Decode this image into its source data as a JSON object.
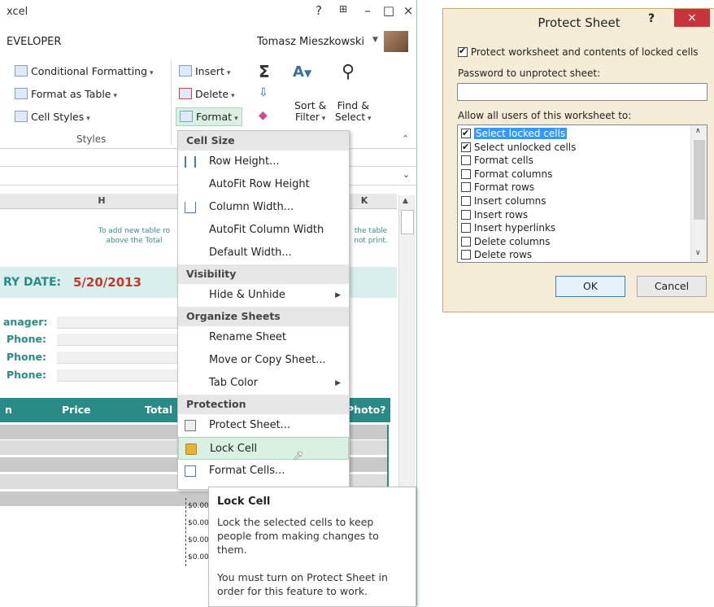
{
  "excel": {
    "title": "xcel",
    "window_buttons": [
      "?",
      "⊞",
      "–",
      "□",
      "×"
    ],
    "tab": "EVELOPER",
    "user": "Tomasz Mieszkowski",
    "ribbon": {
      "styles": {
        "conditional_formatting": "Conditional Formatting",
        "format_as_table": "Format as Table",
        "cell_styles": "Cell Styles",
        "group_label": "Styles"
      },
      "cells": {
        "insert": "Insert",
        "delete": "Delete",
        "format": "Format"
      },
      "editing": {
        "sort_filter": "Sort &",
        "sort_filter_2": "Filter",
        "find_select": "Find &",
        "find_select_2": "Select"
      }
    },
    "columns": [
      "H",
      "K"
    ],
    "sheet": {
      "note_left_1": "To add new table ro",
      "note_left_2": "above  the Total",
      "note_right_1": "the table",
      "note_right_2": "not print.",
      "date_label": "RY DATE:",
      "date_value": "5/20/2013",
      "labels": [
        "anager:",
        "Phone:",
        "Phone:",
        "Phone:"
      ],
      "table_headers": {
        "col1": "n",
        "price": "Price",
        "total": "Total",
        "photo": "Photo?"
      },
      "money_values": [
        "$0.00",
        "$0.00",
        "$0.00",
        "$0.00"
      ]
    }
  },
  "menu": {
    "sections": {
      "cell_size": "Cell Size",
      "visibility": "Visibility",
      "organize": "Organize Sheets",
      "protection": "Protection"
    },
    "items": {
      "row_height": "Row Height...",
      "autofit_row": "AutoFit Row Height",
      "column_width": "Column Width...",
      "autofit_column": "AutoFit Column Width",
      "default_width": "Default Width...",
      "hide_unhide": "Hide & Unhide",
      "rename_sheet": "Rename Sheet",
      "move_copy": "Move or Copy Sheet...",
      "tab_color": "Tab Color",
      "protect_sheet": "Protect Sheet...",
      "lock_cell": "Lock Cell",
      "format_cells": "Format Cells..."
    }
  },
  "tooltip": {
    "title": "Lock Cell",
    "line1": "Lock the selected cells to keep",
    "line2": "people from making changes to",
    "line3": "them.",
    "line4": "You must turn on Protect Sheet in",
    "line5": "order for this feature to work."
  },
  "dialog": {
    "title": "Protect Sheet",
    "help": "?",
    "close": "×",
    "protect_label": "Protect worksheet and contents of locked cells",
    "protect_checked": true,
    "password_label": "Password to unprotect sheet:",
    "password_value": "",
    "allow_label": "Allow all users of this worksheet to:",
    "permissions": [
      {
        "label": "Select locked cells",
        "checked": true,
        "selected": true
      },
      {
        "label": "Select unlocked cells",
        "checked": true,
        "selected": false
      },
      {
        "label": "Format cells",
        "checked": false,
        "selected": false
      },
      {
        "label": "Format columns",
        "checked": false,
        "selected": false
      },
      {
        "label": "Format rows",
        "checked": false,
        "selected": false
      },
      {
        "label": "Insert columns",
        "checked": false,
        "selected": false
      },
      {
        "label": "Insert rows",
        "checked": false,
        "selected": false
      },
      {
        "label": "Insert hyperlinks",
        "checked": false,
        "selected": false
      },
      {
        "label": "Delete columns",
        "checked": false,
        "selected": false
      },
      {
        "label": "Delete rows",
        "checked": false,
        "selected": false
      }
    ],
    "ok": "OK",
    "cancel": "Cancel"
  },
  "colors": {
    "teal": "#2a8b86",
    "date_red": "#c0392b",
    "close_red": "#c7343b",
    "dialog_bg": "#f5ecd7",
    "highlight_green": "#d9f0e2"
  }
}
